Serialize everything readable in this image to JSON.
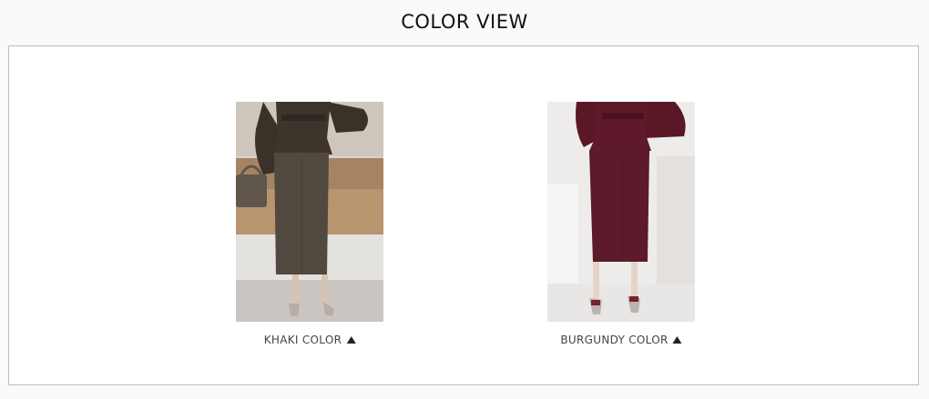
{
  "title": "COLOR VIEW",
  "items": [
    {
      "label": "KHAKI COLOR",
      "color_name": "khaki",
      "swatch": "#4a3f35",
      "icon": "triangle-up-icon"
    },
    {
      "label": "BURGUNDY COLOR",
      "color_name": "burgundy",
      "swatch": "#5a1726",
      "icon": "triangle-up-icon"
    }
  ]
}
